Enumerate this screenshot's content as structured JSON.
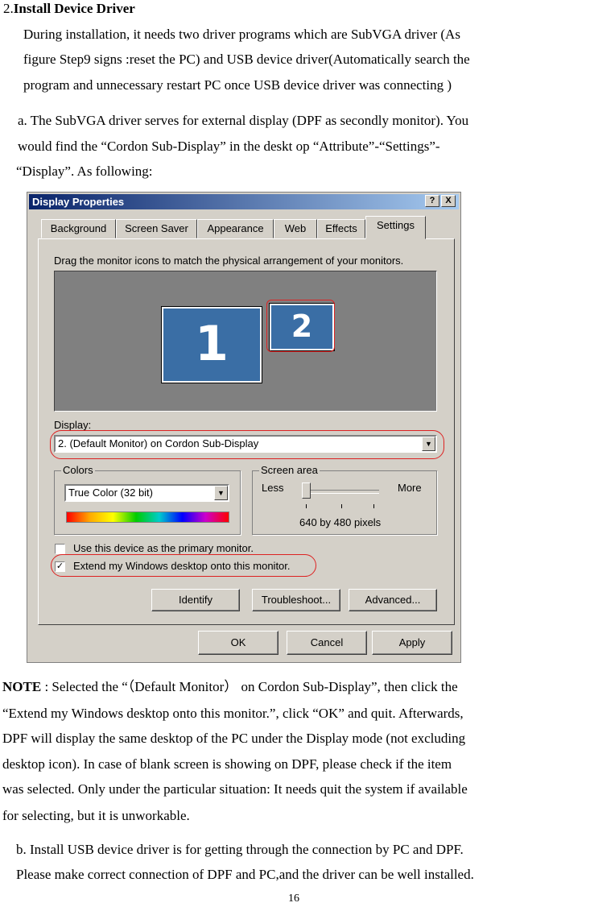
{
  "section": {
    "number": "2.",
    "title": "Install Device Driver",
    "intro_lines": [
      "During installation, it needs two driver programs which are SubVGA driver (As",
      "figure Step9 signs :reset the PC) and USB device driver(Automatically search the",
      "program and unnecessary restart PC once USB device driver was connecting )"
    ],
    "a_lines": [
      "a. The SubVGA driver serves for external display (DPF as secondly monitor). You",
      "would find the “Cordon Sub-Display” in the deskt op “Attribute”-“Settings”-",
      "“Display”.  As following:"
    ]
  },
  "dialog": {
    "title": "Display Properties",
    "help_btn": "?",
    "close_btn": "X",
    "tabs": [
      "Background",
      "Screen Saver",
      "Appearance",
      "Web",
      "Effects",
      "Settings"
    ],
    "instruction": "Drag the monitor icons to match the physical arrangement of your monitors.",
    "monitor1": "1",
    "monitor2": "2",
    "display_label": "Display:",
    "display_value": "2. (Default Monitor) on Cordon Sub-Display",
    "colors_label": "Colors",
    "colors_value": "True Color (32 bit)",
    "screen_area_label": "Screen area",
    "less": "Less",
    "more": "More",
    "resolution": "640 by 480 pixels",
    "primary_check": "Use this device as the primary monitor.",
    "extend_check": "Extend my Windows desktop onto this monitor.",
    "identify": "Identify",
    "troubleshoot": "Troubleshoot...",
    "advanced": "Advanced...",
    "ok": "OK",
    "cancel": "Cancel",
    "apply": "Apply"
  },
  "note": {
    "label": "NOTE",
    "lines": [
      " : Selected the “（Default Monitor）  on Cordon Sub-Display”, then click the",
      "“Extend my Windows desktop onto this monitor.”, click “OK” and quit. Afterwards,",
      "DPF will display the same desktop of the PC under the Display mode (not excluding",
      "desktop  icon). In case of blank screen is showing on DPF, please check if the item",
      "was selected. Only under the particular situation: It needs quit the system if available",
      "for selecting, but  it is unworkable."
    ]
  },
  "b_lines": [
    "b. Install USB device driver is for getting through the connection by PC and DPF.",
    "Please make correct connection of DPF and PC,and the driver can be well installed."
  ],
  "page_number": "16"
}
